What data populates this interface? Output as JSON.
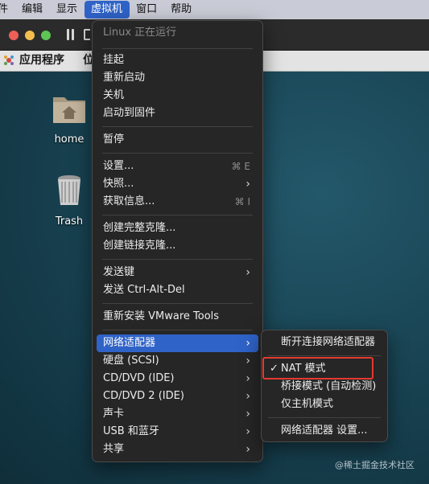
{
  "menubar": {
    "items": [
      {
        "label": "件"
      },
      {
        "label": "编辑"
      },
      {
        "label": "显示"
      },
      {
        "label": "虚拟机"
      },
      {
        "label": "窗口"
      },
      {
        "label": "帮助"
      }
    ]
  },
  "guest": {
    "apps_label": "应用程序",
    "places_label": "位"
  },
  "desktop": {
    "icons": [
      {
        "label": "home",
        "icon": "home-folder-icon"
      },
      {
        "label": "Trash",
        "icon": "trash-icon"
      }
    ]
  },
  "vm_menu": {
    "header": "Linux 正在运行",
    "items": [
      {
        "label": "挂起"
      },
      {
        "label": "重新启动"
      },
      {
        "label": "关机"
      },
      {
        "label": "启动到固件"
      },
      {
        "label": "暂停"
      },
      {
        "label": "设置...",
        "shortcut": "⌘ E"
      },
      {
        "label": "快照...",
        "submenu": true
      },
      {
        "label": "获取信息...",
        "shortcut": "⌘ I"
      },
      {
        "label": "创建完整克隆..."
      },
      {
        "label": "创建链接克隆..."
      },
      {
        "label": "发送键",
        "submenu": true
      },
      {
        "label": "发送 Ctrl-Alt-Del"
      },
      {
        "label": "重新安装 VMware Tools"
      },
      {
        "label": "网络适配器",
        "submenu": true,
        "selected": true
      },
      {
        "label": "硬盘 (SCSI)",
        "submenu": true
      },
      {
        "label": "CD/DVD (IDE)",
        "submenu": true
      },
      {
        "label": "CD/DVD 2 (IDE)",
        "submenu": true
      },
      {
        "label": "声卡",
        "submenu": true
      },
      {
        "label": "USB 和蓝牙",
        "submenu": true
      },
      {
        "label": "共享",
        "submenu": true
      }
    ]
  },
  "network_submenu": {
    "items": [
      {
        "label": "断开连接网络适配器"
      },
      {
        "label": "NAT 模式",
        "checked": true,
        "check": "✓"
      },
      {
        "label": "桥接模式 (自动检测)"
      },
      {
        "label": "仅主机模式"
      },
      {
        "label": "网络适配器 设置..."
      }
    ]
  },
  "arrow_glyph": "›",
  "watermark": "@稀土掘金技术社区",
  "colors": {
    "selection": "#2f63c8",
    "highlight_box": "#e43a2e"
  }
}
